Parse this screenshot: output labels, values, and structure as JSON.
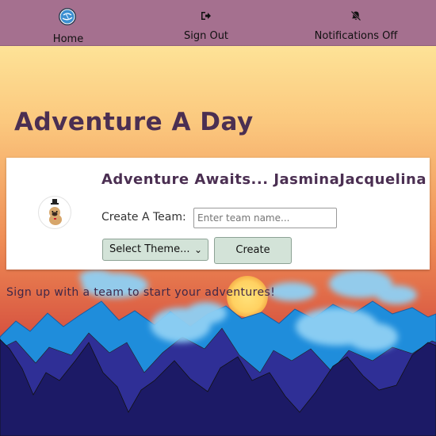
{
  "nav": {
    "home": {
      "label": "Home",
      "icon": "globe-logo-icon"
    },
    "sign_out": {
      "label": "Sign Out",
      "icon": "sign-out-icon"
    },
    "notifications": {
      "label": "Notifications Off",
      "icon": "bell-off-icon"
    }
  },
  "title": "Adventure A Day",
  "card": {
    "greeting": "Adventure Awaits... JasminaJacquelina",
    "create_team_label": "Create A Team:",
    "team_input_placeholder": "Enter team name...",
    "theme_select_value": "Select Theme...",
    "create_button_label": "Create",
    "avatar_icon": "pug-avatar-icon"
  },
  "signup_message": "Sign up with a team to start your adventures!",
  "colors": {
    "navbar": "#a5708f",
    "title": "#4b2f52",
    "button_bg": "#d3e3d8",
    "sky_top": "#fff3a6",
    "sky_bottom": "#c8463c",
    "mountains_back": "#1e8fd8",
    "mountains_front": "#1c1862"
  }
}
